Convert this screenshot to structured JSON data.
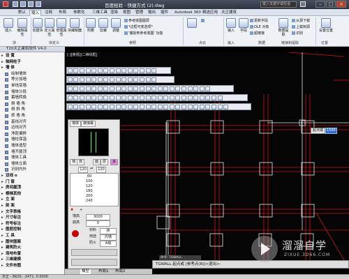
{
  "title_bar": {
    "title": "百度经验 - 快捷方式 (2).dwg",
    "search_placeholder": "键入关键字或短语",
    "file_tab": "Drawing2.dwg"
  },
  "ribbon_tabs": [
    "默认",
    "插入",
    "注释",
    "布局",
    "参数化",
    "三维工具",
    "渲染",
    "视图",
    "管理",
    "输出",
    "插件",
    "Autodesk 360",
    "精选应用",
    "天正建筑"
  ],
  "ribbon": {
    "buttons": [
      "插入",
      "编辑属性",
      "创建块",
      "定义属性",
      "管理属性",
      "块编辑器",
      "附着",
      "剪裁",
      "调整",
      "链接",
      "输入",
      "字段",
      "数据提取",
      "设置位置"
    ],
    "small_items": [
      "参考底图图层",
      "*边框可变选项*",
      "'捕捉到参考底图' 功能",
      "更新字段",
      "OLE 对象",
      "超链接",
      "从源下载",
      "上载到源",
      "识别",
      "识别"
    ],
    "group_labels": [
      "块",
      "块定义",
      "参照",
      "点云",
      "输入",
      "数据",
      "链接和提取",
      "位置"
    ]
  },
  "tianzheng_panel": {
    "header": "T20天正建筑软件 V4.0",
    "items": [
      {
        "label": "设  置",
        "group": true
      },
      {
        "label": "轴网柱子",
        "group": true
      },
      {
        "label": "墙    体",
        "group": true
      },
      {
        "label": "绘制墙体",
        "group": false
      },
      {
        "label": "等分加墙",
        "group": false
      },
      {
        "label": "单线变墙",
        "group": false
      },
      {
        "label": "墙体分段",
        "group": false
      },
      {
        "label": "幕墙转换",
        "group": false
      },
      {
        "label": "倒  墙  角",
        "group": false
      },
      {
        "label": "倒  斜  角",
        "group": false
      },
      {
        "label": "修  墙  角",
        "group": false
      },
      {
        "label": "基线对齐",
        "group": false
      },
      {
        "label": "边线对齐",
        "group": false
      },
      {
        "label": "净距偏移",
        "group": false
      },
      {
        "label": "墙柱保温",
        "group": false
      },
      {
        "label": "墙体造型",
        "group": false
      },
      {
        "label": "墙齐屋顶",
        "group": false
      },
      {
        "label": "墙体工具",
        "group": false
      },
      {
        "label": "墙体立面",
        "group": false
      },
      {
        "label": "识别内外",
        "group": false
      },
      {
        "label": "双线 o",
        "group": true
      },
      {
        "label": "门    窗",
        "group": true
      },
      {
        "label": "房间屋顶",
        "group": true
      },
      {
        "label": "楼梯其他",
        "group": true
      },
      {
        "label": "立    面",
        "group": true
      },
      {
        "label": "剖    面",
        "group": true
      },
      {
        "label": "文字表格",
        "group": true
      },
      {
        "label": "尺寸标注",
        "group": true
      },
      {
        "label": "符号标注",
        "group": true
      },
      {
        "label": "图层控制",
        "group": true
      },
      {
        "label": "工    具",
        "group": true
      },
      {
        "label": "图块图案",
        "group": true
      },
      {
        "label": "建筑防火",
        "group": true
      },
      {
        "label": "场地布置",
        "group": true
      },
      {
        "label": "三维建模",
        "group": true
      },
      {
        "label": "文件布图",
        "group": true
      }
    ]
  },
  "viewport_label": "[-][俯视][二维线框]",
  "layer_panel": {
    "tabs": [
      "墙体",
      "玻璃幕"
    ],
    "sub_tabs": [
      "墙",
      "体",
      "面",
      "层",
      "多"
    ],
    "top_values": [
      "120",
      "120"
    ],
    "width_list": [
      "60",
      "100",
      "120",
      "180",
      "200",
      "240"
    ],
    "fields": [
      {
        "label": "墙高",
        "value": "3000"
      },
      {
        "label": "底高",
        "value": "0"
      }
    ],
    "props": [
      {
        "label": "材料",
        "value": "砖"
      },
      {
        "label": "用途",
        "value": "内墙"
      },
      {
        "label": "防火",
        "value": "A级"
      }
    ]
  },
  "command": {
    "history": "命令: TGWALL",
    "line": "TGWALL 起点或 [参考点(R)]<退出>:"
  },
  "dynamic_input": {
    "label": "起点或",
    "value": "1500"
  },
  "layout_tabs": [
    "模型",
    "布局1",
    "布局2"
  ],
  "status_bar": "天正 - 8620.  -2471.  0.0000",
  "watermark": {
    "name": "溜溜自学",
    "url": "ZIXUE.3D66.COM"
  }
}
